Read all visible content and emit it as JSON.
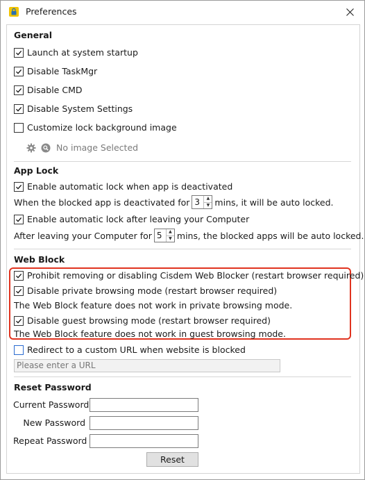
{
  "window": {
    "title": "Preferences"
  },
  "general": {
    "title": "General",
    "items": [
      {
        "label": "Launch at system startup",
        "checked": true
      },
      {
        "label": "Disable TaskMgr",
        "checked": true
      },
      {
        "label": "Disable CMD",
        "checked": true
      },
      {
        "label": "Disable System Settings",
        "checked": true
      },
      {
        "label": "Customize lock background image",
        "checked": false
      }
    ],
    "image_status": "No image Selected"
  },
  "app_lock": {
    "title": "App Lock",
    "deactivated_label": "Enable automatic lock when app is deactivated",
    "deactivated_checked": true,
    "deactivated_prefix": "When the blocked app is deactivated for",
    "deactivated_value": "3",
    "deactivated_suffix": "mins, it will be auto locked.",
    "leaving_label": "Enable automatic lock after leaving your Computer",
    "leaving_checked": true,
    "leaving_prefix": "After leaving your Computer for",
    "leaving_value": "5",
    "leaving_suffix": "mins, the blocked apps will be auto locked."
  },
  "web_block": {
    "title": "Web Block",
    "prohibit_label": "Prohibit removing or disabling Cisdem Web Blocker (restart browser required)",
    "private_label": "Disable private browsing mode (restart browser required)",
    "private_note": "The Web Block feature does not work in private browsing mode.",
    "guest_label": "Disable guest browsing mode (restart browser required)",
    "guest_note": "The Web Block feature does not work in guest browsing mode.",
    "redirect_label": "Redirect to a custom URL when website is blocked",
    "url_placeholder": "Please enter a URL",
    "highlight_color": "#e0331f"
  },
  "reset_password": {
    "title": "Reset Password",
    "current_label": "Current Password",
    "new_label": "New Password",
    "repeat_label": "Repeat Password",
    "reset_label": "Reset"
  }
}
